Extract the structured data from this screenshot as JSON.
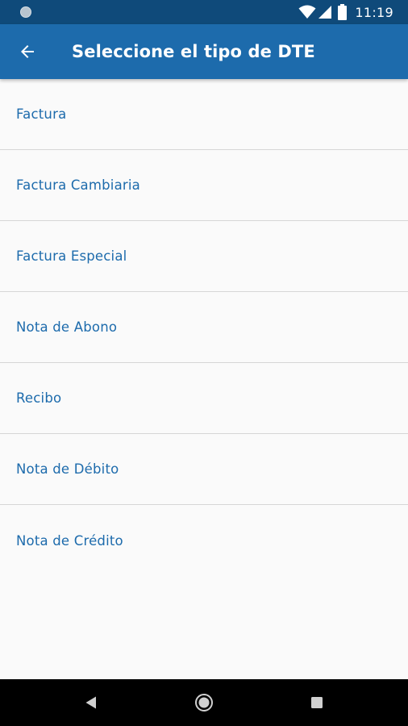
{
  "status_bar": {
    "time": "11:19",
    "icons": [
      "notification-dot-icon",
      "wifi-icon",
      "cell-signal-icon",
      "battery-icon"
    ]
  },
  "app_bar": {
    "title": "Seleccione el tipo de DTE",
    "back_icon": "arrow-left-icon"
  },
  "document_types": [
    {
      "label": "Factura"
    },
    {
      "label": "Factura Cambiaria"
    },
    {
      "label": "Factura Especial"
    },
    {
      "label": "Nota de Abono"
    },
    {
      "label": "Recibo"
    },
    {
      "label": "Nota de Débito"
    },
    {
      "label": "Nota de Crédito"
    }
  ],
  "nav_bar": {
    "icons": [
      "nav-back-icon",
      "nav-home-icon",
      "nav-recent-icon"
    ]
  },
  "colors": {
    "status_bar": "#0f4a7a",
    "app_bar": "#1d6bac",
    "item_text": "#1d6bac",
    "background": "#fafafa",
    "divider": "#d6d6d6"
  }
}
